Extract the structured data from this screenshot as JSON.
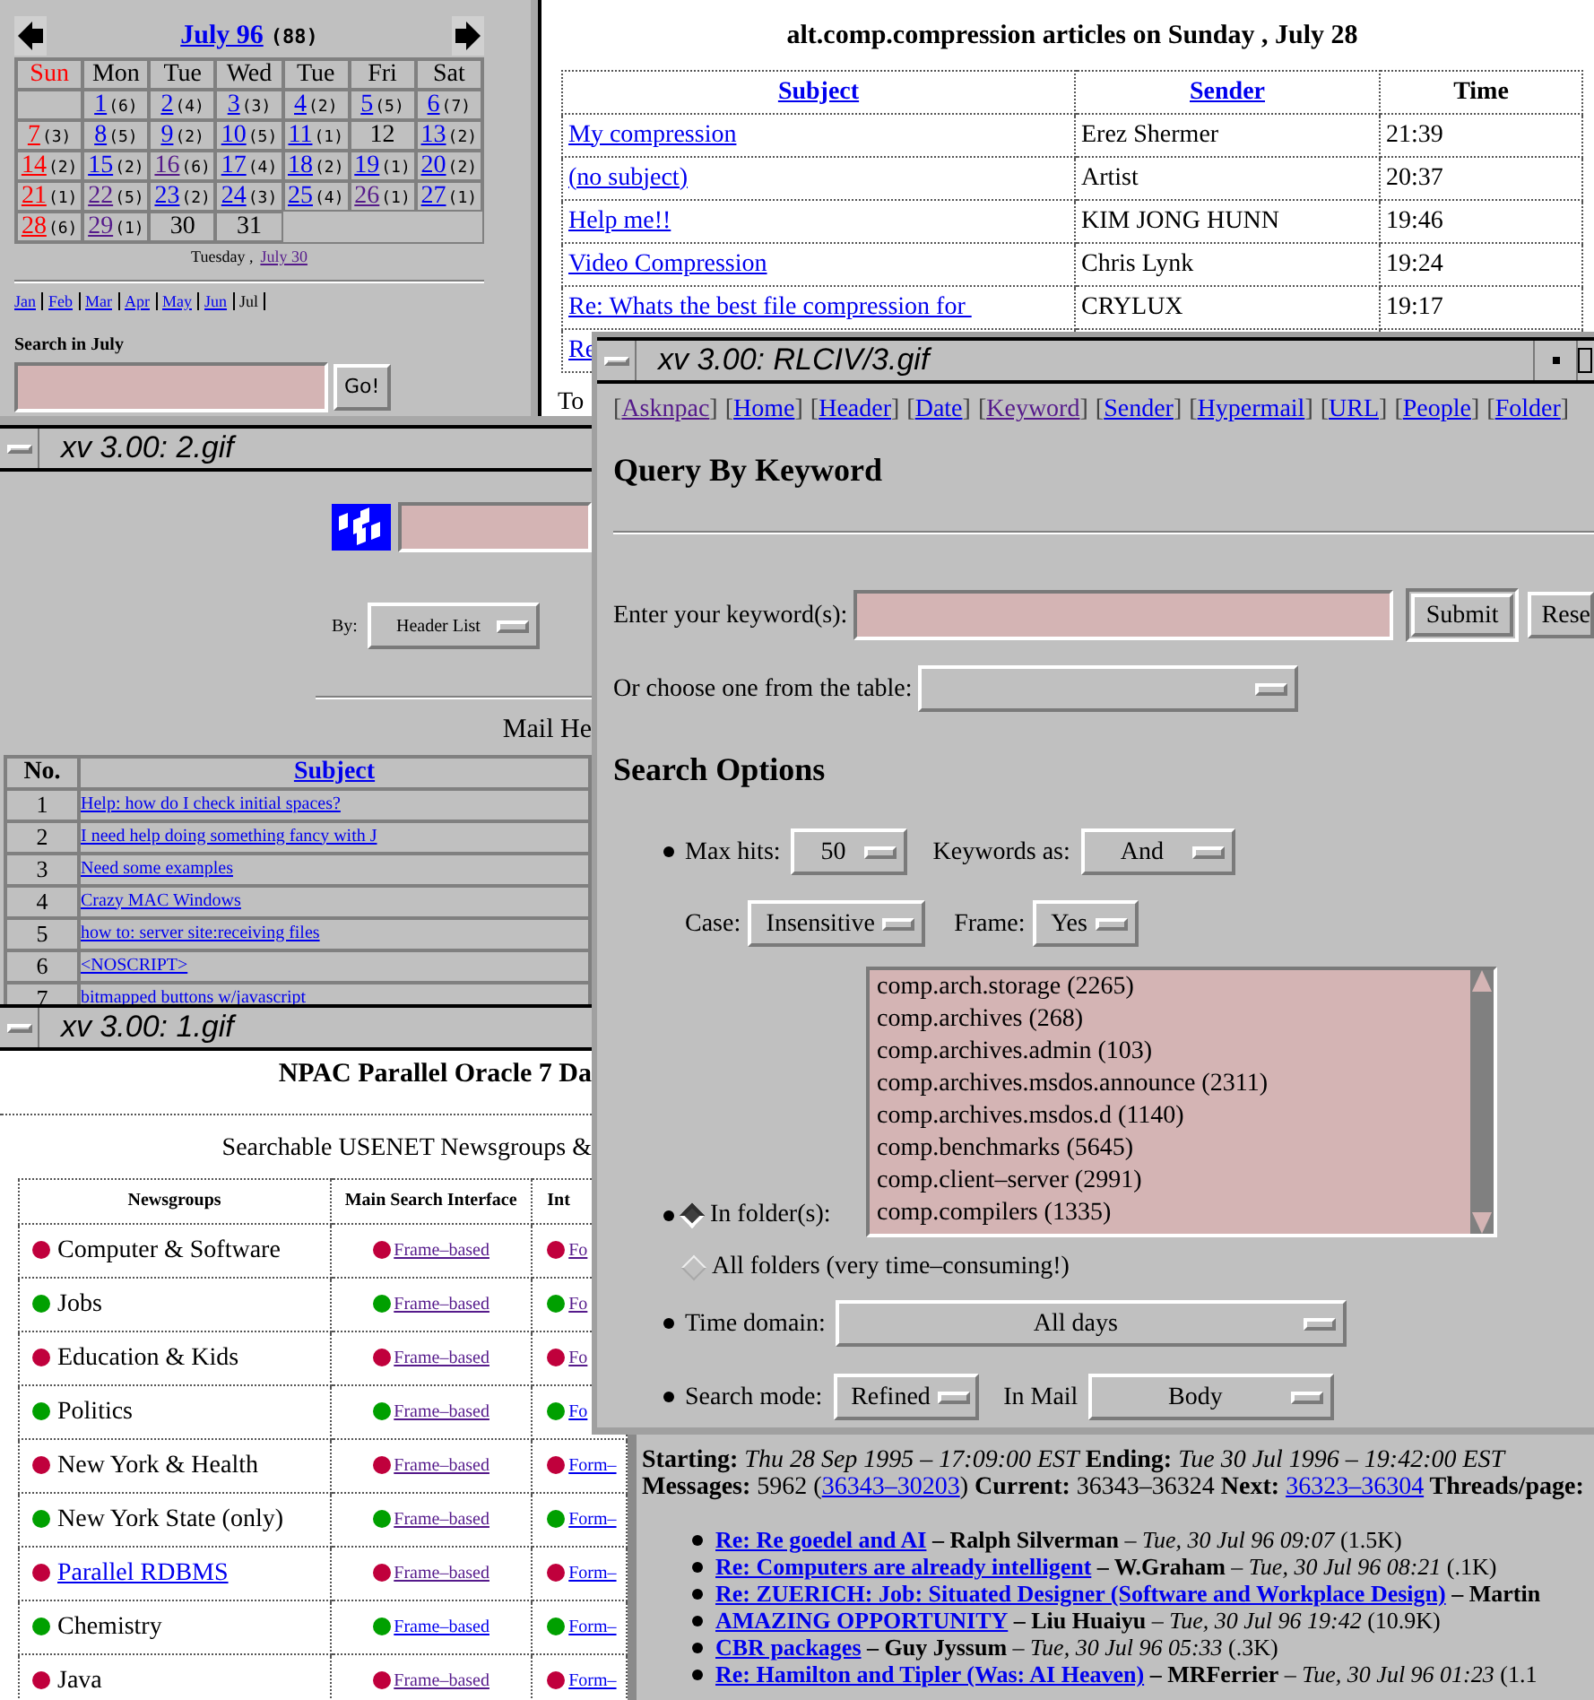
{
  "calendar": {
    "title": "July 96",
    "count": "(88)",
    "weekdays": [
      {
        "label": "Sun",
        "kind": "sunday"
      },
      {
        "label": "Mon",
        "kind": "normal"
      },
      {
        "label": "Tue",
        "kind": "normal"
      },
      {
        "label": "Wed",
        "kind": "normal"
      },
      {
        "label": "Tue",
        "kind": "normal"
      },
      {
        "label": "Fri",
        "kind": "normal"
      },
      {
        "label": "Sat",
        "kind": "normal"
      }
    ],
    "weeks": [
      [
        {
          "kind": "blank"
        },
        {
          "day": "1",
          "count": "(6)",
          "kind": "link"
        },
        {
          "day": "2",
          "count": "(4)",
          "kind": "link"
        },
        {
          "day": "3",
          "count": "(3)",
          "kind": "link"
        },
        {
          "day": "4",
          "count": "(2)",
          "kind": "link"
        },
        {
          "day": "5",
          "count": "(5)",
          "kind": "link"
        },
        {
          "day": "6",
          "count": "(7)",
          "kind": "link"
        }
      ],
      [
        {
          "day": "7",
          "count": "(3)",
          "kind": "sunday"
        },
        {
          "day": "8",
          "count": "(5)",
          "kind": "link"
        },
        {
          "day": "9",
          "count": "(2)",
          "kind": "link"
        },
        {
          "day": "10",
          "count": "(5)",
          "kind": "link"
        },
        {
          "day": "11",
          "count": "(1)",
          "kind": "link"
        },
        {
          "day": "12",
          "kind": "plain"
        },
        {
          "day": "13",
          "count": "(2)",
          "kind": "link"
        }
      ],
      [
        {
          "day": "14",
          "count": "(2)",
          "kind": "sunday"
        },
        {
          "day": "15",
          "count": "(2)",
          "kind": "link"
        },
        {
          "day": "16",
          "count": "(6)",
          "kind": "visited"
        },
        {
          "day": "17",
          "count": "(4)",
          "kind": "link"
        },
        {
          "day": "18",
          "count": "(2)",
          "kind": "link"
        },
        {
          "day": "19",
          "count": "(1)",
          "kind": "link"
        },
        {
          "day": "20",
          "count": "(2)",
          "kind": "link"
        }
      ],
      [
        {
          "day": "21",
          "count": "(1)",
          "kind": "sunday"
        },
        {
          "day": "22",
          "count": "(5)",
          "kind": "visited"
        },
        {
          "day": "23",
          "count": "(2)",
          "kind": "link"
        },
        {
          "day": "24",
          "count": "(3)",
          "kind": "link"
        },
        {
          "day": "25",
          "count": "(4)",
          "kind": "link"
        },
        {
          "day": "26",
          "count": "(1)",
          "kind": "visited"
        },
        {
          "day": "27",
          "count": "(1)",
          "kind": "link"
        }
      ],
      [
        {
          "day": "28",
          "count": "(6)",
          "kind": "sunday"
        },
        {
          "day": "29",
          "count": "(1)",
          "kind": "visited"
        },
        {
          "day": "30",
          "kind": "plain"
        },
        {
          "day": "31",
          "kind": "plain"
        }
      ]
    ],
    "caption": {
      "prefix": "Tuesday ,",
      "link": "July 30"
    },
    "months": [
      {
        "label": "Jan",
        "link": true
      },
      {
        "label": "Feb",
        "link": true
      },
      {
        "label": "Mar",
        "link": true
      },
      {
        "label": "Apr",
        "link": true
      },
      {
        "label": "May",
        "link": true
      },
      {
        "label": "Jun",
        "link": true
      },
      {
        "label": "Jul",
        "link": false
      }
    ],
    "search_label": "Search in July",
    "go_button": "Go!"
  },
  "articles": {
    "title": "alt.comp.compression articles on Sunday , July 28",
    "columns": [
      {
        "label": "Subject",
        "link": true
      },
      {
        "label": "Sender",
        "link": true
      },
      {
        "label": "Time",
        "link": false
      }
    ],
    "rows": [
      {
        "subject": "My compression",
        "sender": "Erez Shermer",
        "time": "21:39"
      },
      {
        "subject": "(no subject)",
        "sender": "Artist",
        "time": "20:37"
      },
      {
        "subject": "Help me!!",
        "sender": "KIM JONG HUNN",
        "time": "19:46"
      },
      {
        "subject": "Video Compression",
        "sender": "Chris Lynk",
        "time": "19:24"
      },
      {
        "subject": "Re: Whats the best file compression for ",
        "sender": "CRYLUX",
        "time": "19:17"
      },
      {
        "subject": "Re"
      }
    ],
    "footer_text": "To"
  },
  "window_2": {
    "title": "xv 3.00: 2.gif",
    "by_label": "By:",
    "by_value": "Header List",
    "heading": "Mail He",
    "columns": [
      "No.",
      "Subject"
    ],
    "rows": [
      {
        "no": "1",
        "subject": "Help: how do I check initial spaces?"
      },
      {
        "no": "2",
        "subject": "I need help doing something fancy with J"
      },
      {
        "no": "3",
        "subject": "Need some examples"
      },
      {
        "no": "4",
        "subject": "Crazy MAC Windows"
      },
      {
        "no": "5",
        "subject": "how to: server site:receiving files"
      },
      {
        "no": "6",
        "subject": "<NOSCRIPT>"
      },
      {
        "no": "7",
        "subject": "bitmapped buttons w/javascript"
      }
    ]
  },
  "window_1": {
    "title": "xv 3.00: 1.gif",
    "heading": "NPAC Parallel Oracle 7 Da",
    "subheading": "Searchable USENET Newsgroups &",
    "columns": [
      "Newsgroups",
      "Main Search Interface",
      "Int"
    ],
    "rows": [
      {
        "color": "#c0003c",
        "name": "Computer & Software",
        "name_link": false,
        "main": {
          "text": "Frame–based",
          "visited": true
        },
        "int": {
          "text": "Fo",
          "visited": true
        }
      },
      {
        "color": "#00a000",
        "name": "Jobs",
        "name_link": false,
        "main": {
          "text": "Frame–based",
          "visited": true
        },
        "int": {
          "text": "Fo",
          "visited": true
        }
      },
      {
        "color": "#c0003c",
        "name": "Education & Kids",
        "name_link": false,
        "main": {
          "text": "Frame–based",
          "visited": true
        },
        "int": {
          "text": "Fo",
          "visited": true
        }
      },
      {
        "color": "#00a000",
        "name": "Politics",
        "name_link": false,
        "main": {
          "text": "Frame–based",
          "visited": true
        },
        "int": {
          "text": "Fo",
          "visited": false
        }
      },
      {
        "color": "#c0003c",
        "name": "New York & Health",
        "name_link": false,
        "main": {
          "text": "Frame–based",
          "visited": true
        },
        "int": {
          "text": "Form–",
          "visited": false
        }
      },
      {
        "color": "#00a000",
        "name": "New York State (only)",
        "name_link": false,
        "main": {
          "text": "Frame–based",
          "visited": true
        },
        "int": {
          "text": "Form–",
          "visited": false
        }
      },
      {
        "color": "#c0003c",
        "name": "Parallel RDBMS",
        "name_link": true,
        "main": {
          "text": "Frame–based",
          "visited": true
        },
        "int": {
          "text": "Form–",
          "visited": false
        }
      },
      {
        "color": "#00a000",
        "name": "Chemistry",
        "name_link": false,
        "main": {
          "text": "Frame–based",
          "visited": false
        },
        "int": {
          "text": "Form–",
          "visited": false
        }
      },
      {
        "color": "#c0003c",
        "name": "Java",
        "name_link": false,
        "main": {
          "text": "Frame–based",
          "visited": true
        },
        "int": {
          "text": "Form–",
          "visited": false
        }
      }
    ]
  },
  "rlciv": {
    "title": "xv 3.00: RLCIV/3.gif",
    "nav": [
      {
        "open": "[",
        "label": "Asknpac",
        "close": "]",
        "visited": true
      },
      {
        "open": "[",
        "label": "Home",
        "close": "]",
        "visited": false
      },
      {
        "open": "[",
        "label": "Header",
        "close": "]",
        "visited": false
      },
      {
        "open": "[",
        "label": "Date",
        "close": "]",
        "visited": false
      },
      {
        "open": "[",
        "label": "Keyword",
        "close": "]",
        "visited": true
      },
      {
        "open": "[",
        "label": "Sender",
        "close": "]",
        "visited": false
      },
      {
        "open": "[",
        "label": "Hypermail",
        "close": "]",
        "visited": false
      },
      {
        "open": "[",
        "label": "URL",
        "close": "]",
        "visited": false
      },
      {
        "open": "[",
        "label": "People",
        "close": "]",
        "visited": false
      },
      {
        "open": "[",
        "label": "Folder",
        "close": "]",
        "visited": false
      }
    ],
    "heading": "Query By Keyword",
    "keyword_label": "Enter your keyword(s):",
    "submit": "Submit",
    "reset": "Rese",
    "table_label": "Or choose one from the table:",
    "options_heading": "Search Options",
    "max_hits_label": "Max hits:",
    "max_hits": "50",
    "keywords_as_label": "Keywords as:",
    "keywords_as": "And",
    "case_label": "Case:",
    "case": "Insensitive",
    "frame_label": "Frame:",
    "frame": "Yes",
    "folders": [
      "comp.arch.storage (2265)",
      "comp.archives (268)",
      "comp.archives.admin (103)",
      "comp.archives.msdos.announce (2311)",
      "comp.archives.msdos.d (1140)",
      "comp.benchmarks (5645)",
      "comp.client–server (2991)",
      "comp.compilers (1335)"
    ],
    "folder_options": [
      {
        "label": "In folder(s):",
        "selected": true
      },
      {
        "label": "All folders (very time–consuming!)",
        "selected": false
      }
    ],
    "time_domain_label": "Time domain:",
    "time_domain": "All days",
    "search_mode_label": "Search mode:",
    "search_mode": "Refined",
    "in_mail_label": "In Mail",
    "in_mail": "Body"
  },
  "messages": {
    "summary": "**Starting:** *Thu 28 Sep 1995 – 17:09:00 EST* **Ending:** *Tue 30 Jul 1996 – 19:42:00 EST*",
    "counts": [
      {
        "kind": "label",
        "text": "Messages: "
      },
      {
        "kind": "text",
        "text": "5962 ("
      },
      {
        "kind": "link",
        "text": "36343–30203"
      },
      {
        "kind": "text",
        "text": ") "
      },
      {
        "kind": "label",
        "text": "Current: "
      },
      {
        "kind": "text",
        "text": "36343–36324 "
      },
      {
        "kind": "label",
        "text": "Next: "
      },
      {
        "kind": "link",
        "text": "36323–36304"
      },
      {
        "kind": "label",
        "text": " Threads/page:"
      }
    ],
    "threads": [
      {
        "subject": "Re: Re goedel and AI",
        "sender": "– Ralph Silverman",
        "date": "– Tue, 30 Jul 96 09:07",
        "size": "(1.5K)"
      },
      {
        "subject": "Re: Computers are already intelligent",
        "sender": "– W.Graham",
        "date": "– Tue, 30 Jul 96 08:21",
        "size": "(.1K)"
      },
      {
        "subject": "Re: ZUERICH: Job: Situated Designer (Software and Workplace Design)",
        "sender": "– Martin"
      },
      {
        "subject": "AMAZING OPPORTUNITY",
        "sender": "– Liu Huaiyu",
        "date": "– Tue, 30 Jul 96 19:42",
        "size": "(10.9K)"
      },
      {
        "subject": "CBR packages",
        "sender": "– Guy Jyssum",
        "date": "– Tue, 30 Jul 96 05:33",
        "size": "(.3K)"
      },
      {
        "subject": "Re: Hamilton and Tipler (Was: AI Heaven)",
        "sender": "– MRFerrier",
        "date": "– Tue, 30 Jul 96 01:23",
        "size": "(1.1"
      }
    ]
  }
}
